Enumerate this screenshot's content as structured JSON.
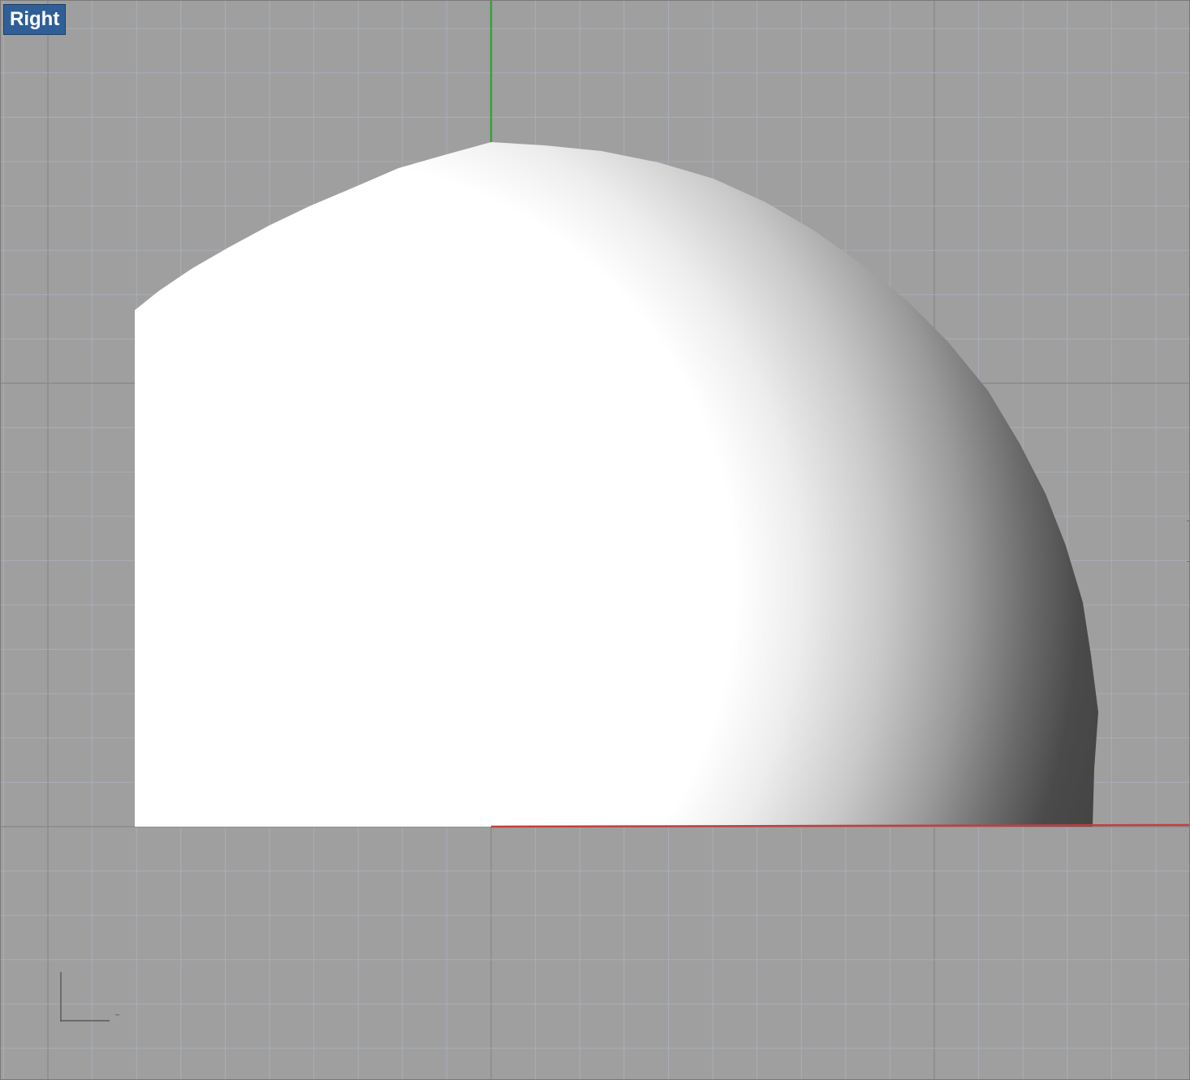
{
  "viewport": {
    "label": "Right",
    "projection": "parallel",
    "display_mode": "shaded"
  },
  "axes": {
    "vertical_axis_color": "#3aa03a",
    "horizontal_axis_color": "#c04040"
  },
  "grid": {
    "visible": true,
    "background_color": "#9f9f9f",
    "minor_line_color": "#a9aeb8",
    "major_line_color": "#8a8a8a"
  },
  "object": {
    "type": "sphere (cut)",
    "icon": "sphere-shaded-icon",
    "highlight_color": "#ffffff",
    "shadow_color": "#444444"
  },
  "widgets": {
    "world_axes_icon": "world-axes-icon"
  }
}
